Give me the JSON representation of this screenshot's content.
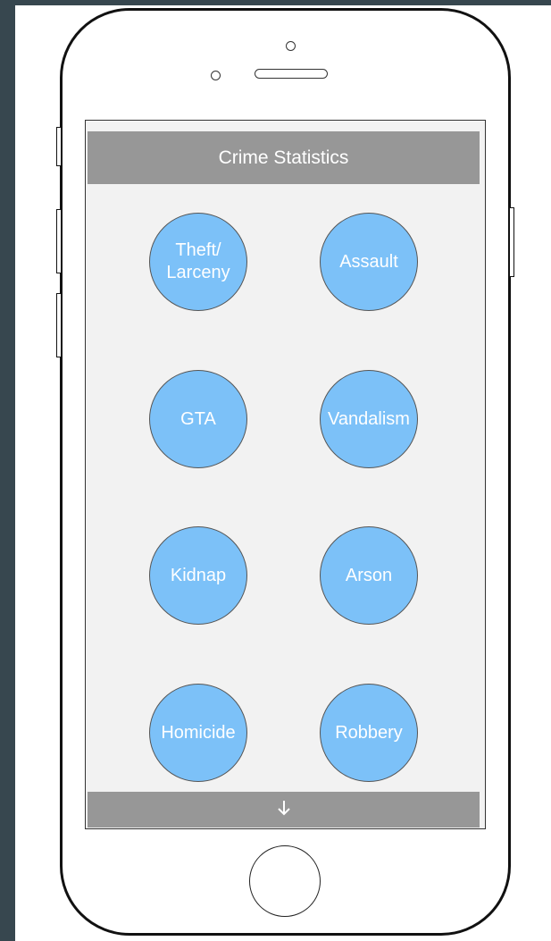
{
  "app": {
    "title": "Crime Statistics"
  },
  "crimes": [
    {
      "label": "Theft/ Larceny",
      "lines": [
        "Theft/",
        "Larceny"
      ]
    },
    {
      "label": "Assault",
      "lines": [
        "Assault"
      ]
    },
    {
      "label": "GTA",
      "lines": [
        "GTA"
      ]
    },
    {
      "label": "Vandalism",
      "lines": [
        "Vandalism"
      ]
    },
    {
      "label": "Kidnap",
      "lines": [
        "Kidnap"
      ]
    },
    {
      "label": "Arson",
      "lines": [
        "Arson"
      ]
    },
    {
      "label": "Homicide",
      "lines": [
        "Homicide"
      ]
    },
    {
      "label": "Robbery",
      "lines": [
        "Robbery"
      ]
    }
  ],
  "footer": {
    "icon": "arrow-down-icon",
    "glyph": "↓"
  },
  "colors": {
    "header_bg": "#979797",
    "button_fill": "#7cc1f8",
    "page_bg": "#37474f"
  }
}
